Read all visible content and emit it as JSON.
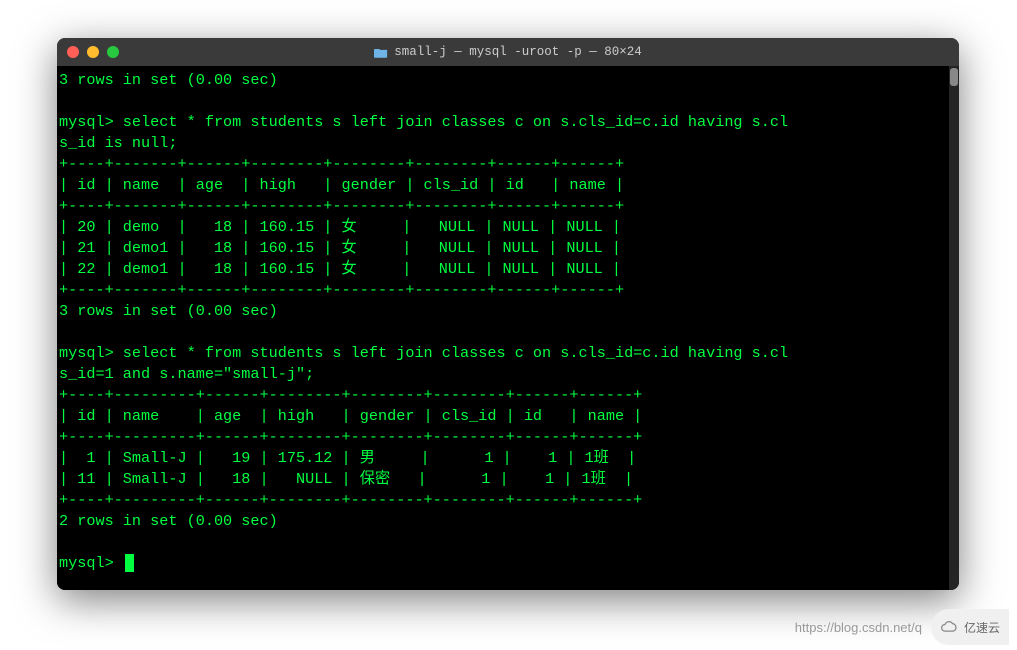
{
  "window": {
    "title": "small-j — mysql -uroot -p — 80×24"
  },
  "terminal": {
    "lines": [
      "3 rows in set (0.00 sec)",
      "",
      "mysql> select * from students s left join classes c on s.cls_id=c.id having s.cl",
      "s_id is null;",
      "+----+-------+------+--------+--------+--------+------+------+",
      "| id | name  | age  | high   | gender | cls_id | id   | name |",
      "+----+-------+------+--------+--------+--------+------+------+",
      "| 20 | demo  |   18 | 160.15 | 女     |   NULL | NULL | NULL |",
      "| 21 | demo1 |   18 | 160.15 | 女     |   NULL | NULL | NULL |",
      "| 22 | demo1 |   18 | 160.15 | 女     |   NULL | NULL | NULL |",
      "+----+-------+------+--------+--------+--------+------+------+",
      "3 rows in set (0.00 sec)",
      "",
      "mysql> select * from students s left join classes c on s.cls_id=c.id having s.cl",
      "s_id=1 and s.name=\"small-j\";",
      "+----+---------+------+--------+--------+--------+------+------+",
      "| id | name    | age  | high   | gender | cls_id | id   | name |",
      "+----+---------+------+--------+--------+--------+------+------+",
      "|  1 | Small-J |   19 | 175.12 | 男     |      1 |    1 | 1班  |",
      "| 11 | Small-J |   18 |   NULL | 保密   |      1 |    1 | 1班  |",
      "+----+---------+------+--------+--------+--------+------+------+",
      "2 rows in set (0.00 sec)",
      "",
      "mysql> "
    ]
  },
  "watermark": {
    "text": "https://blog.csdn.net/q",
    "logo": "亿速云"
  },
  "chart_data": {
    "type": "table",
    "tables": [
      {
        "query": "select * from students s left join classes c on s.cls_id=c.id having s.cls_id is null;",
        "columns": [
          "id",
          "name",
          "age",
          "high",
          "gender",
          "cls_id",
          "id",
          "name"
        ],
        "rows": [
          [
            20,
            "demo",
            18,
            160.15,
            "女",
            "NULL",
            "NULL",
            "NULL"
          ],
          [
            21,
            "demo1",
            18,
            160.15,
            "女",
            "NULL",
            "NULL",
            "NULL"
          ],
          [
            22,
            "demo1",
            18,
            160.15,
            "女",
            "NULL",
            "NULL",
            "NULL"
          ]
        ],
        "summary": "3 rows in set (0.00 sec)"
      },
      {
        "query": "select * from students s left join classes c on s.cls_id=c.id having s.cls_id=1 and s.name=\"small-j\";",
        "columns": [
          "id",
          "name",
          "age",
          "high",
          "gender",
          "cls_id",
          "id",
          "name"
        ],
        "rows": [
          [
            1,
            "Small-J",
            19,
            175.12,
            "男",
            1,
            1,
            "1班"
          ],
          [
            11,
            "Small-J",
            18,
            "NULL",
            "保密",
            1,
            1,
            "1班"
          ]
        ],
        "summary": "2 rows in set (0.00 sec)"
      }
    ]
  }
}
